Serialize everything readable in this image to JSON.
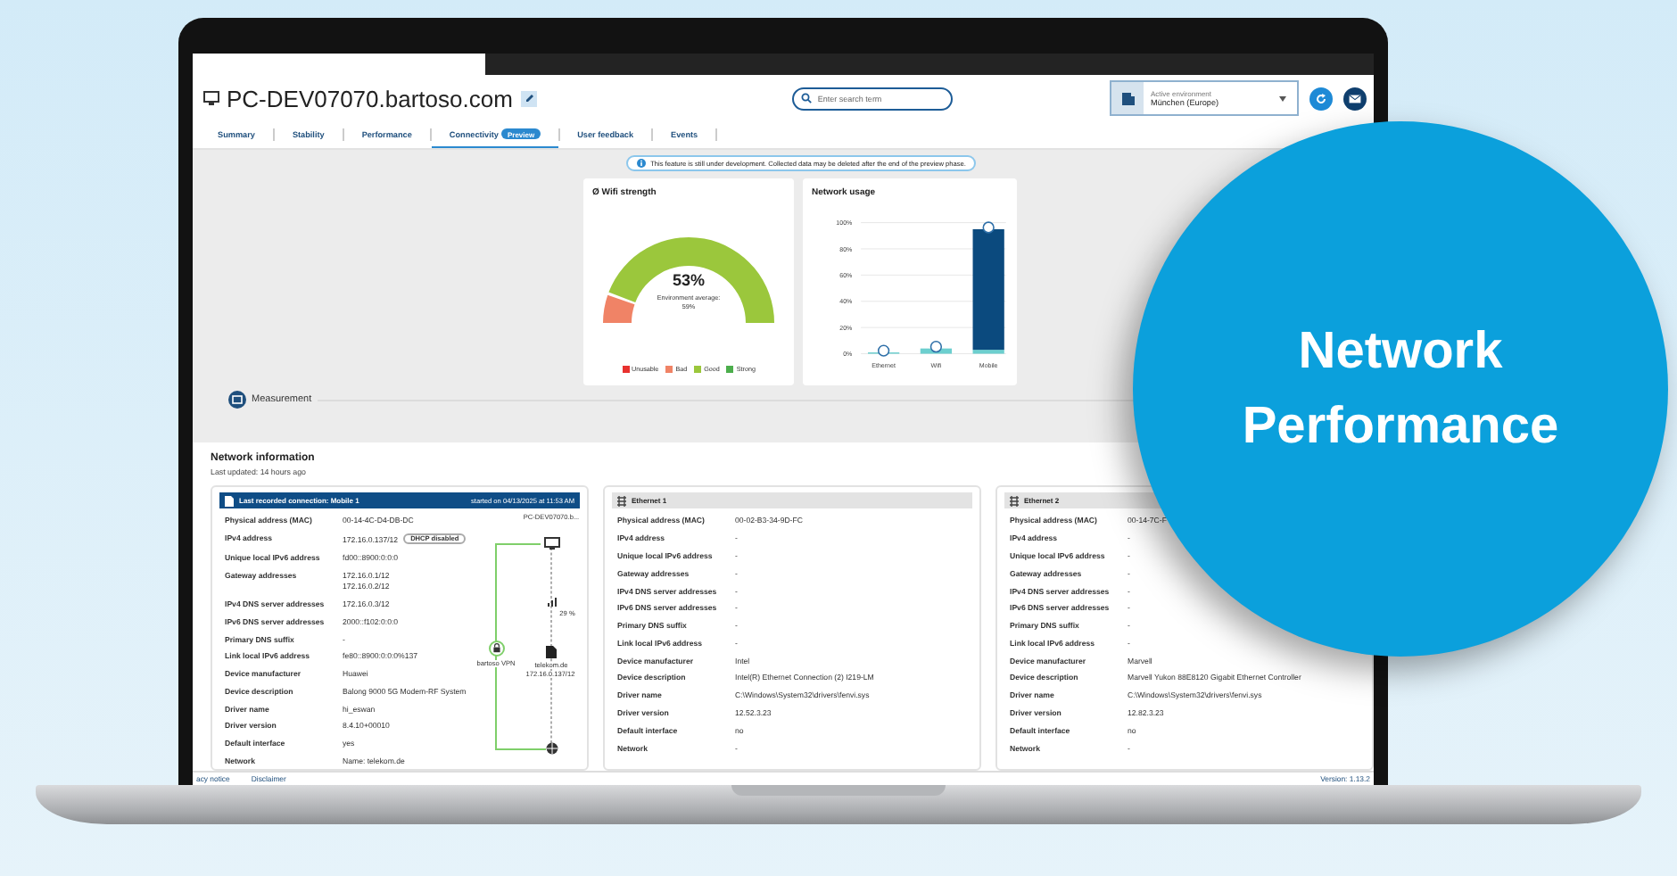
{
  "screen": {
    "header": {
      "title": "PC-DEV07070.bartoso.com",
      "search": {
        "placeholder": "Enter search term"
      },
      "environment": {
        "label": "Active environment",
        "value": "München (Europe)"
      }
    },
    "tabs": [
      {
        "label": "Summary",
        "selected": false
      },
      {
        "label": "Stability",
        "selected": false
      },
      {
        "label": "Performance",
        "selected": false
      },
      {
        "label": "Connectivity",
        "badge": "Preview",
        "selected": true
      },
      {
        "label": "User feedback",
        "selected": false
      },
      {
        "label": "Events",
        "selected": false
      }
    ],
    "notice": "This feature is still under development. Collected data may be deleted after the end of the preview phase.",
    "wifi_strength": {
      "title": "Ø Wifi strength",
      "value": "53%",
      "average_label": "Environment average:",
      "average": "59%",
      "legend": [
        {
          "label": "Unusable",
          "color": "#e8312f"
        },
        {
          "label": "Bad",
          "color": "#f08366"
        },
        {
          "label": "Good",
          "color": "#9bc73c"
        },
        {
          "label": "Strong",
          "color": "#4cae4c"
        }
      ]
    },
    "network_usage": {
      "title": "Network usage",
      "chart_data": {
        "type": "bar",
        "categories": [
          "Ethernet",
          "Wifi",
          "Mobile"
        ],
        "stacked": true,
        "grid": true,
        "ylim": [
          0,
          100
        ],
        "yticks": [
          {
            "value": 0,
            "label": "0%"
          },
          {
            "value": 20,
            "label": "20%"
          },
          {
            "value": 40,
            "label": "40%"
          },
          {
            "value": 60,
            "label": "60%"
          },
          {
            "value": 80,
            "label": "80%"
          },
          {
            "value": 100,
            "label": "100%"
          }
        ],
        "series": [
          {
            "color": "#6ccfcf",
            "values": [
              1,
              4,
              3
            ]
          },
          {
            "color": "#0b4a7e",
            "values": [
              0,
              0,
              92
            ]
          }
        ]
      }
    },
    "measurement": "Measurement",
    "network_information": {
      "title": "Network information",
      "last_updated": "Last updated: 14 hours ago",
      "adapters": [
        {
          "kind": "recorded",
          "title": "Last recorded connection: Mobile 1",
          "started": "started on 04/13/2025 at 11:53 AM",
          "rows": [
            {
              "label": "Physical address (MAC)",
              "values": [
                "00-14-4C-D4-DB-DC"
              ]
            },
            {
              "label": "IPv4 address",
              "values": [
                "172.16.0.137/12"
              ],
              "badge": "DHCP disabled"
            },
            {
              "label": "Unique local IPv6 address",
              "values": [
                "fd00::8900:0:0:0"
              ]
            },
            {
              "label": "Gateway addresses",
              "values": [
                "172.16.0.1/12",
                "172.16.0.2/12"
              ]
            },
            {
              "label": "IPv4 DNS server addresses",
              "values": [
                "172.16.0.3/12"
              ]
            },
            {
              "label": "IPv6 DNS server addresses",
              "values": [
                "2000::f102:0:0:0"
              ]
            },
            {
              "label": "Primary DNS suffix",
              "values": [
                "-"
              ]
            },
            {
              "label": "Link local IPv6 address",
              "values": [
                "fe80::8900:0:0:0%137"
              ]
            },
            {
              "label": "Device manufacturer",
              "values": [
                "Huawei"
              ]
            },
            {
              "label": "Device description",
              "values": [
                "Balong 9000 5G Modem-RF System"
              ]
            },
            {
              "label": "Driver name",
              "values": [
                "hi_eswan"
              ]
            },
            {
              "label": "Driver version",
              "values": [
                "8.4.10+00010"
              ]
            },
            {
              "label": "Default interface",
              "values": [
                "yes"
              ]
            },
            {
              "label": "Network",
              "values": [
                "Name: telekom.de"
              ]
            }
          ],
          "diagram": {
            "device": "PC-DEV07070.b...",
            "signal": "29 %",
            "provider": "telekom.de",
            "ip": "172.16.0.137/12",
            "vpn": "bartoso VPN"
          }
        },
        {
          "kind": "adapter",
          "title": "Ethernet 1",
          "rows": [
            {
              "label": "Physical address (MAC)",
              "values": [
                "00-02-B3-34-9D-FC"
              ]
            },
            {
              "label": "IPv4 address",
              "values": [
                "-"
              ]
            },
            {
              "label": "Unique local IPv6 address",
              "values": [
                "-"
              ]
            },
            {
              "label": "Gateway addresses",
              "values": [
                "-"
              ]
            },
            {
              "label": "IPv4 DNS server addresses",
              "values": [
                "-"
              ]
            },
            {
              "label": "IPv6 DNS server addresses",
              "values": [
                "-"
              ]
            },
            {
              "label": "Primary DNS suffix",
              "values": [
                "-"
              ]
            },
            {
              "label": "Link local IPv6 address",
              "values": [
                "-"
              ]
            },
            {
              "label": "Device manufacturer",
              "values": [
                "Intel"
              ]
            },
            {
              "label": "Device description",
              "values": [
                "Intel(R) Ethernet Connection (2) I219-LM"
              ]
            },
            {
              "label": "Driver name",
              "values": [
                "C:\\Windows\\System32\\drivers\\fenvi.sys"
              ]
            },
            {
              "label": "Driver version",
              "values": [
                "12.52.3.23"
              ]
            },
            {
              "label": "Default interface",
              "values": [
                "no"
              ]
            },
            {
              "label": "Network",
              "values": [
                "-"
              ]
            }
          ]
        },
        {
          "kind": "adapter",
          "title": "Ethernet 2",
          "rows": [
            {
              "label": "Physical address (MAC)",
              "values": [
                "00-14-7C-F"
              ]
            },
            {
              "label": "IPv4 address",
              "values": [
                "-"
              ]
            },
            {
              "label": "Unique local IPv6 address",
              "values": [
                "-"
              ]
            },
            {
              "label": "Gateway addresses",
              "values": [
                "-"
              ]
            },
            {
              "label": "IPv4 DNS server addresses",
              "values": [
                "-"
              ]
            },
            {
              "label": "IPv6 DNS server addresses",
              "values": [
                "-"
              ]
            },
            {
              "label": "Primary DNS suffix",
              "values": [
                "-"
              ]
            },
            {
              "label": "Link local IPv6 address",
              "values": [
                "-"
              ]
            },
            {
              "label": "Device manufacturer",
              "values": [
                "Marvell"
              ]
            },
            {
              "label": "Device description",
              "values": [
                "Marvell Yukon 88E8120 Gigabit Ethernet Controller"
              ]
            },
            {
              "label": "Driver name",
              "values": [
                "C:\\Windows\\System32\\drivers\\fenvi.sys"
              ]
            },
            {
              "label": "Driver version",
              "values": [
                "12.82.3.23"
              ]
            },
            {
              "label": "Default interface",
              "values": [
                "no"
              ]
            },
            {
              "label": "Network",
              "values": [
                "-"
              ]
            }
          ]
        }
      ]
    },
    "footer": {
      "links": [
        "acy notice",
        "Disclaimer"
      ],
      "version": "Version: 1.13.2"
    }
  },
  "promo": {
    "title": "Network Performance"
  }
}
